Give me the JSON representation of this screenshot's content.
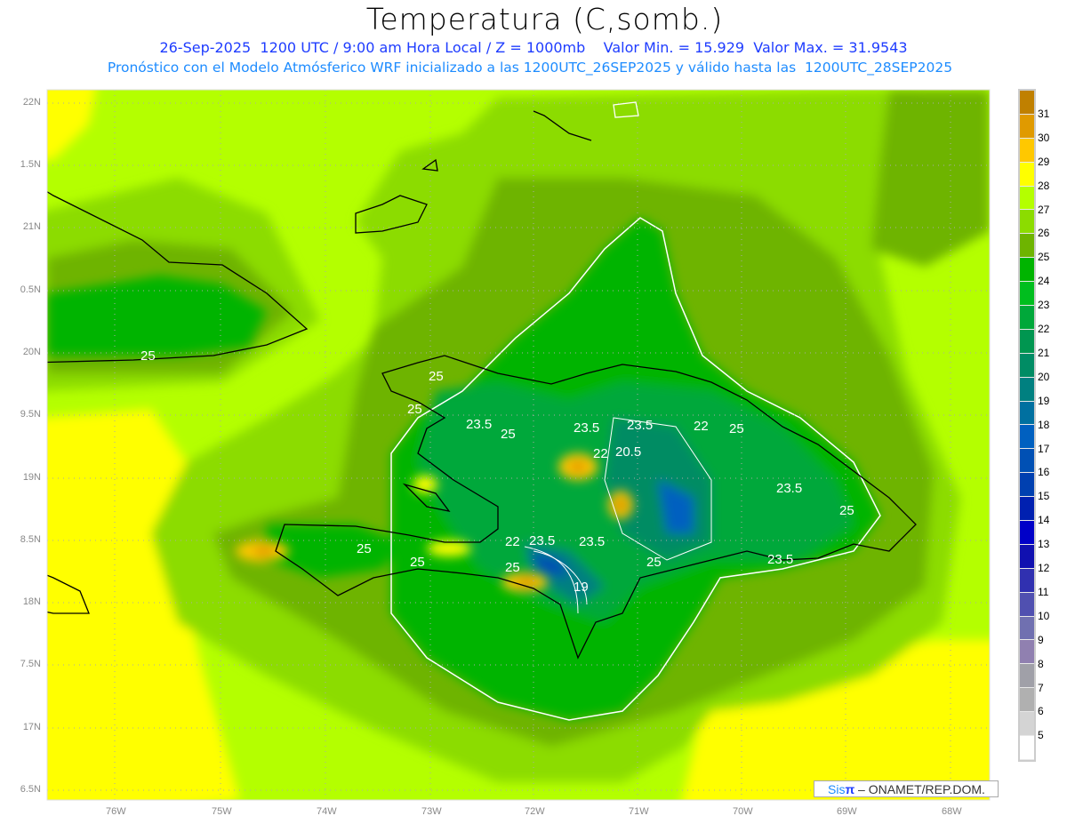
{
  "title": "Temperatura (C,somb.)",
  "subtitle_line1": "26-Sep-2025  1200 UTC / 9:00 am Hora Local / Z = 1000mb    Valor Min. = 15.929  Valor Max. = 31.9543",
  "subtitle_line2": "Pronóstico con el Modelo Atmósferico WRF inicializado a las 1200UTC_26SEP2025 y válido hasta las  1200UTC_28SEP2025",
  "x_axis_labels": [
    "76W",
    "75W",
    "74W",
    "73W",
    "72W",
    "71W",
    "70W",
    "69W",
    "68W"
  ],
  "y_axis_labels": [
    "22N",
    "1.5N",
    "21N",
    "0.5N",
    "20N",
    "9.5N",
    "19N",
    "8.5N",
    "18N",
    "7.5N",
    "17N",
    "6.5N"
  ],
  "colorbar": {
    "labels": [
      "31",
      "30",
      "29",
      "28",
      "27",
      "26",
      "25",
      "24",
      "23",
      "22",
      "21",
      "20",
      "19",
      "18",
      "17",
      "16",
      "15",
      "14",
      "13",
      "12",
      "11",
      "10",
      "9",
      "8",
      "7",
      "6",
      "5"
    ],
    "colors": [
      "#c08000",
      "#e09a00",
      "#ffc800",
      "#ffff00",
      "#b4ff00",
      "#8cdc00",
      "#6eb400",
      "#00b400",
      "#00be1e",
      "#00a83a",
      "#009650",
      "#008c64",
      "#008080",
      "#0070a0",
      "#0060c0",
      "#0050b4",
      "#0040b0",
      "#0020b0",
      "#0000c8",
      "#1010b0",
      "#3030b0",
      "#5050b0",
      "#7070b0",
      "#9080b0",
      "#a0a0a8",
      "#b0b0b0",
      "#d4d4d4",
      "#ffffff"
    ]
  },
  "contour_labels": [
    "25",
    "25",
    "25",
    "23.5",
    "25",
    "23.5",
    "23.5",
    "22",
    "25",
    "22",
    "20.5",
    "23.5",
    "25",
    "25",
    "25",
    "22",
    "23.5",
    "23.5",
    "23.5",
    "25",
    "25",
    "19"
  ],
  "credit": {
    "sis": "Sis",
    "pi": "π",
    "rest": " –  ONAMET/REP.DOM."
  }
}
